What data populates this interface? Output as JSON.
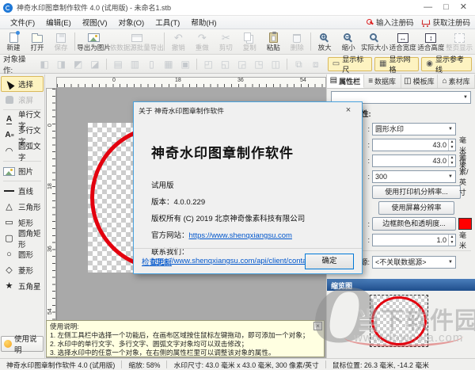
{
  "window": {
    "title": "神奇水印图章制作软件 4.0 (试用版) - 未命名1.stb",
    "minimize": "—",
    "maximize": "□",
    "close": "✕"
  },
  "menubar": {
    "items": [
      "文件(F)",
      "编辑(E)",
      "视图(V)",
      "对象(O)",
      "工具(T)",
      "帮助(H)"
    ],
    "register_input": "输入注册码",
    "register_get": "获取注册码"
  },
  "toolbar1": {
    "items": [
      {
        "label": "新建"
      },
      {
        "label": "打开"
      },
      {
        "label": "保存"
      },
      {
        "label": "导出为图片"
      },
      {
        "label": "依数据源批量导出"
      },
      {
        "label": "撤销"
      },
      {
        "label": "重做"
      },
      {
        "label": "剪切"
      },
      {
        "label": "复制"
      },
      {
        "label": "粘贴"
      },
      {
        "label": "删除"
      },
      {
        "label": "放大"
      },
      {
        "label": "缩小"
      },
      {
        "label": "实际大小"
      },
      {
        "label": "适合宽度"
      },
      {
        "label": "适合高度"
      },
      {
        "label": "整页显示"
      }
    ]
  },
  "toolbar2": {
    "caption": "对象操作:",
    "toggles": [
      {
        "label": "显示标尺"
      },
      {
        "label": "显示网格"
      },
      {
        "label": "显示参考线"
      }
    ]
  },
  "sidebar": {
    "tools": [
      {
        "label": "选择"
      },
      {
        "label": "滚屏"
      },
      {
        "label": "单行文字"
      },
      {
        "label": "多行文字"
      },
      {
        "label": "圆弧文字"
      },
      {
        "label": "图片"
      },
      {
        "label": "直线"
      },
      {
        "label": "三角形"
      },
      {
        "label": "矩形"
      },
      {
        "label": "圆角矩形"
      },
      {
        "label": "圆形"
      },
      {
        "label": "菱形"
      },
      {
        "label": "五角星"
      }
    ],
    "help_button": "使用说明"
  },
  "rulers": {
    "h_labels": [
      "0",
      "18",
      "36",
      "54"
    ],
    "v_labels": [
      "0",
      "18",
      "36",
      "54"
    ]
  },
  "instructions": {
    "title": "使用说明:",
    "lines": [
      "1. 左侧工具栏中选择一个功能后，在画布区域按住鼠标左键拖动，即可添加一个对象；",
      "2. 水印中的单行文字、多行文字、圆弧文字对象均可以双击修改；",
      "3. 选择水印中的任意一个对象，在右侧的属性栏里可以调整该对象的属性。"
    ],
    "close": "×"
  },
  "right_panel": {
    "tabs": [
      {
        "label": "属性栏"
      },
      {
        "label": "数据库"
      },
      {
        "label": "模板库"
      },
      {
        "label": "素材库"
      }
    ],
    "top_combo_value": "",
    "heading_fragment": "性:",
    "type_row": {
      "label_fragment": ":",
      "value": "圆形水印"
    },
    "width_row": {
      "label_fragment": ":",
      "value": "43.0",
      "unit": "毫米"
    },
    "height_row": {
      "label_fragment": ":",
      "value": "43.0",
      "unit": "毫米"
    },
    "dpi_row": {
      "label_fragment": ":",
      "value": "300",
      "unit": "像素/英寸"
    },
    "printer_res_button": "使用打印机分辨率...",
    "screen_res_button": "使用屏幕分辨率",
    "border_row": {
      "label_fragment": ":",
      "button": "边框颜色和透明度...",
      "swatch_color": "#ff0000"
    },
    "border_width_row": {
      "label_fragment": ":",
      "value": "1.0",
      "unit": "毫米"
    },
    "datasource_row": {
      "label_fragment": "源:",
      "value": "<不关联数据源>"
    },
    "thumbnail_header": "缩览图"
  },
  "dialog": {
    "title": "关于 神奇水印图章制作软件",
    "close": "×",
    "heading": "神奇水印图章制作软件",
    "trial": "试用版",
    "version": "版本：4.0.0.229",
    "copyright": "版权所有 (C) 2019 北京神奇像素科技有限公司",
    "site_label": "官方网站：",
    "site_url": "https://www.shenqxiangsu.com",
    "contact_label": "联系我们：",
    "contact_url": "https://www.shenqxiangsu.com/api/client/contact",
    "check_update": "检查更新",
    "ok": "确定"
  },
  "statusbar": {
    "app": "神奇水印图章制作软件 4.0 (试用版)",
    "zoom": "缩放: 58%",
    "size": "水印尺寸: 43.0 毫米 x 43.0 毫米, 300 像素/英寸",
    "mouse": "鼠标位置: 26.3 毫米, -14.2 毫米"
  },
  "watermark": {
    "logo_letter": "O",
    "site": "当下软件园",
    "url": "www.downxia.com"
  },
  "colors": {
    "stamp_red": "#e3000e",
    "swatch_red": "#ff0000",
    "selection_yellow": "#fdf3c1",
    "thumb_header_blue": "#2b5797",
    "dialog_border_blue": "#4aa3df",
    "link_blue": "#0056cc",
    "register_red": "#cc2222"
  }
}
